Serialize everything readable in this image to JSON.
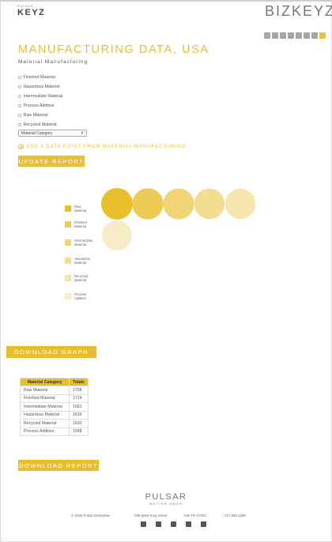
{
  "header": {
    "logo_tag": "PULSAR",
    "logo_text": "KEYZ",
    "brand": "BIZKEYZ"
  },
  "toolbar": {
    "icons": [
      "list-icon",
      "bar-chart-icon",
      "document-icon",
      "bookmark-icon",
      "refresh-icon",
      "settings-icon",
      "mail-icon",
      "close-icon"
    ]
  },
  "page": {
    "title": "MANUFACTURING DATA, USA",
    "subtitle": "Material Manufacturing"
  },
  "filters": {
    "items": [
      "Finished Material",
      "Hazardous Material",
      "Intermediate Material",
      "Process Additive",
      "Raw Material",
      "Recycled Material"
    ],
    "select_value": "Material Category"
  },
  "actions": {
    "add_point": "ADD A DATA POINT FROM MATERIAL MANUFACTURING",
    "update": "UPDATE REPORT",
    "download_graph": "DOWNLOAD GRAPH",
    "download_report": "DOWNLOAD REPORT"
  },
  "chart_data": {
    "type": "bubble",
    "series": [
      {
        "name": "Raw Material",
        "value": 1758,
        "color": "#e9bf2c"
      },
      {
        "name": "Finished Material",
        "value": 1714,
        "color": "#eecb55"
      },
      {
        "name": "Intermediate Material",
        "value": 1681,
        "color": "#f1d575"
      },
      {
        "name": "Hazardous Material",
        "value": 1639,
        "color": "#f3dd90"
      },
      {
        "name": "Recycled Material",
        "value": 1620,
        "color": "#f5e5ad"
      },
      {
        "name": "Process Additive",
        "value": 1588,
        "color": "#f8ecc8"
      }
    ]
  },
  "table": {
    "headers": [
      "Material Category",
      "Totals"
    ],
    "rows": [
      [
        "Raw Material",
        "1758"
      ],
      [
        "Finished Material",
        "1714"
      ],
      [
        "Intermediate Material",
        "1681"
      ],
      [
        "Hazardous Material",
        "1639"
      ],
      [
        "Recycled Material",
        "1620"
      ],
      [
        "Process Additive",
        "1588"
      ]
    ]
  },
  "footer": {
    "brand": "PULSAR",
    "tagline": "MATTER MORE",
    "copyright": "© 2026 Pulsar Enterprise",
    "address": "255 West King Street",
    "city": "York PA 17401",
    "phone": "717.650.1196",
    "social": [
      "facebook-icon",
      "document-icon",
      "linkedin-icon",
      "x-icon",
      "youtube-icon"
    ]
  }
}
